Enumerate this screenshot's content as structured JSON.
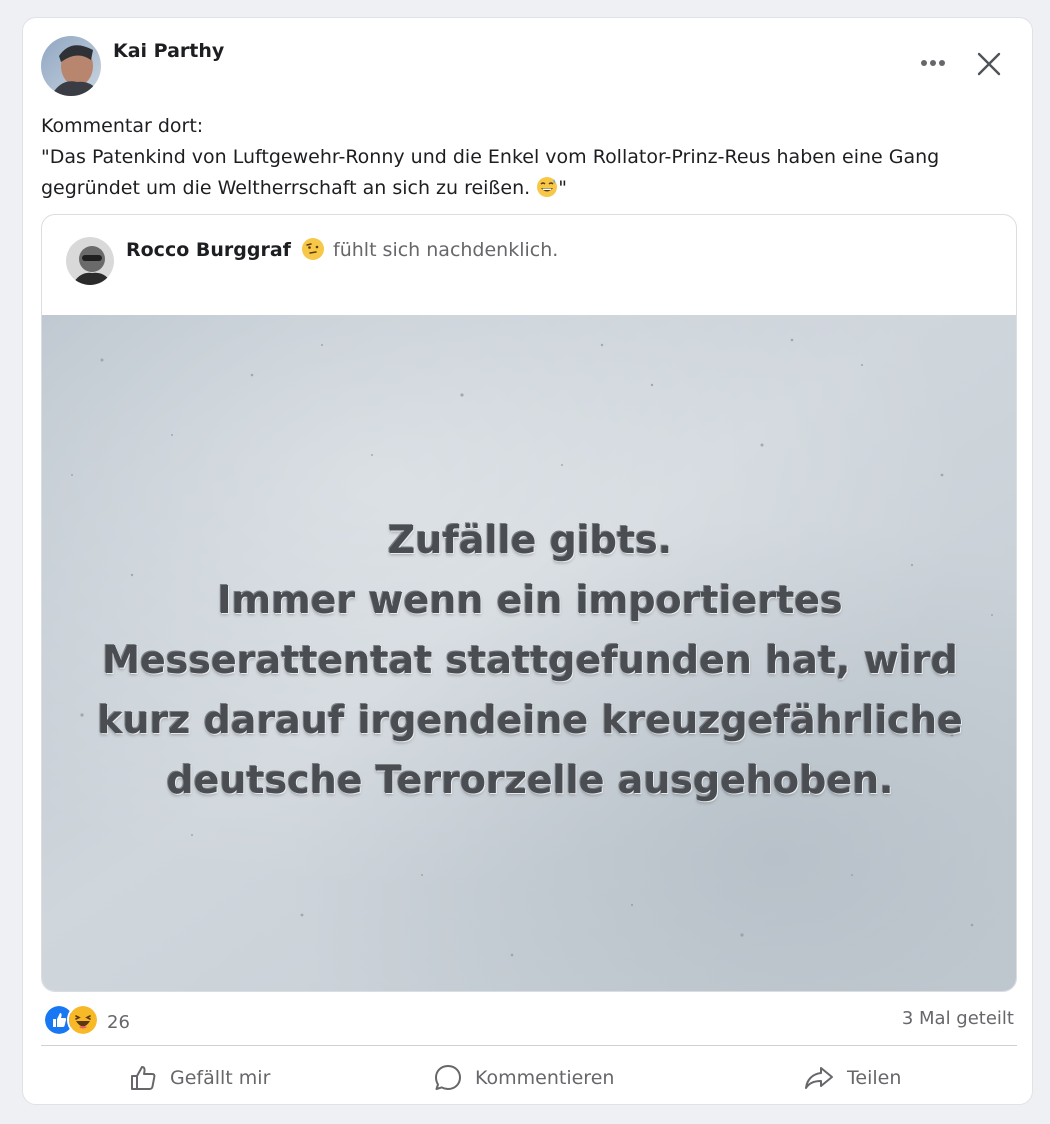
{
  "post": {
    "author": "Kai Parthy",
    "text_lines": [
      "Kommentar dort:",
      "\"Das Patenkind von Luftgewehr-Ronny und die Enkel vom Rollator-Prinz-Reus haben eine Gang",
      "gegründet um die Weltherrschaft an sich zu reißen. "
    ],
    "text_end": "\"",
    "inline_emoji": "grinning-sweat-emoji"
  },
  "shared": {
    "author": "Rocco Burggraf",
    "feeling_emoji": "thinking-face-emoji",
    "feeling_text": "fühlt sich nachdenklich.",
    "image_text": [
      "Zufälle gibts.",
      "Immer wenn ein importiertes",
      "Messerattentat stattgefunden hat, wird",
      "kurz darauf irgendeine kreuzgefährliche",
      "deutsche Terrorzelle ausgehoben."
    ]
  },
  "stats": {
    "reaction_icons": [
      "like-reaction-icon",
      "haha-reaction-icon"
    ],
    "reaction_count": "26",
    "shares": "3 Mal geteilt"
  },
  "actions": {
    "like": "Gefällt mir",
    "comment": "Kommentieren",
    "share": "Teilen"
  },
  "colors": {
    "like_blue": "#1877f2",
    "haha_yellow": "#f7b928",
    "secondary_text": "#65676b"
  }
}
